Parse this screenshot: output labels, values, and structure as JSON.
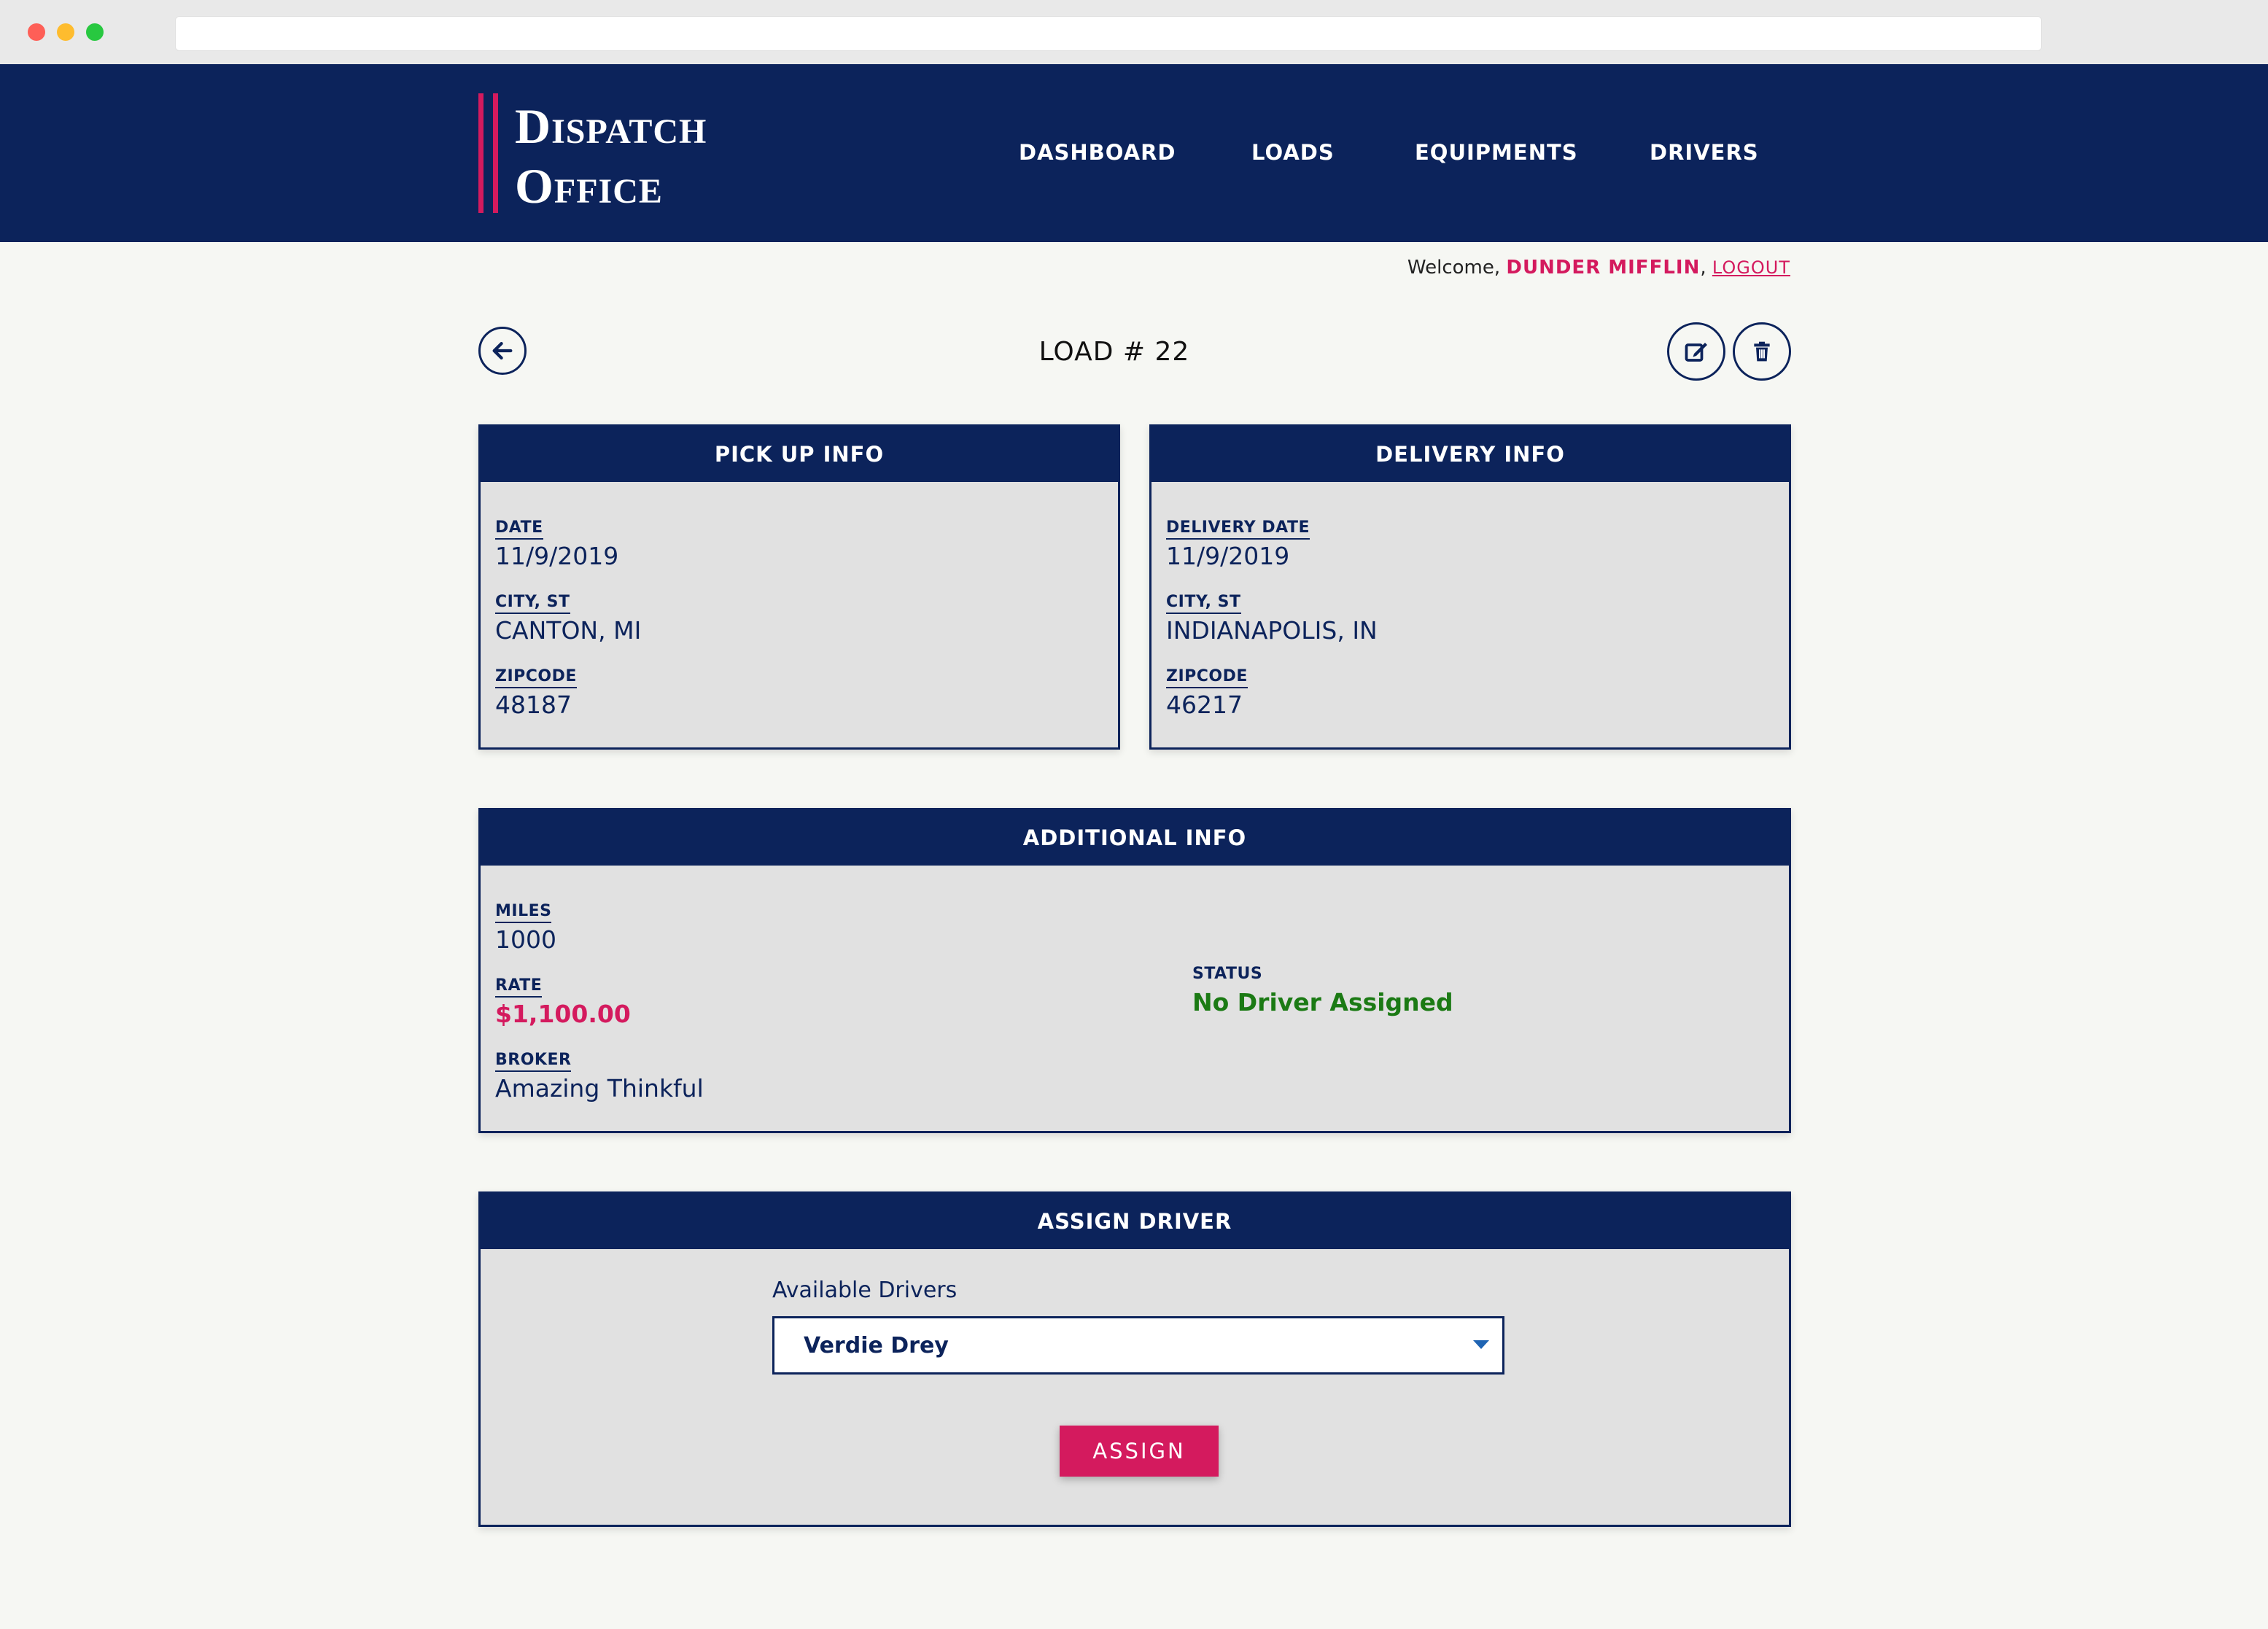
{
  "header": {
    "logo_line1": "Dispatch",
    "logo_line2": "Office",
    "nav": [
      "DASHBOARD",
      "LOADS",
      "EQUIPMENTS",
      "DRIVERS"
    ]
  },
  "welcome": {
    "prefix": "Welcome,",
    "company": "DUNDER MIFFLIN",
    "separator": ",",
    "logout": "LOGOUT"
  },
  "page": {
    "title": "LOAD # 22"
  },
  "pickup": {
    "heading": "PICK UP INFO",
    "date_label": "DATE",
    "date": "11/9/2019",
    "city_label": "CITY, ST",
    "city": "CANTON, MI",
    "zip_label": "ZIPCODE",
    "zip": "48187"
  },
  "delivery": {
    "heading": "DELIVERY INFO",
    "date_label": "DELIVERY DATE",
    "date": "11/9/2019",
    "city_label": "CITY, ST",
    "city": "INDIANAPOLIS, IN",
    "zip_label": "ZIPCODE",
    "zip": "46217"
  },
  "additional": {
    "heading": "ADDITIONAL INFO",
    "miles_label": "MILES",
    "miles": "1000",
    "rate_label": "RATE",
    "rate": "$1,100.00",
    "broker_label": "BROKER",
    "broker": "Amazing Thinkful",
    "status_label": "STATUS",
    "status": "No Driver Assigned"
  },
  "assign": {
    "heading": "ASSIGN DRIVER",
    "select_label": "Available Drivers",
    "selected_driver": "Verdie Drey",
    "button": "ASSIGN"
  },
  "colors": {
    "navy": "#0c235b",
    "accent": "#d41a5e",
    "status_green": "#1b7a14",
    "panel_gray": "#e1e1e1",
    "page_bg": "#f6f7f3"
  }
}
